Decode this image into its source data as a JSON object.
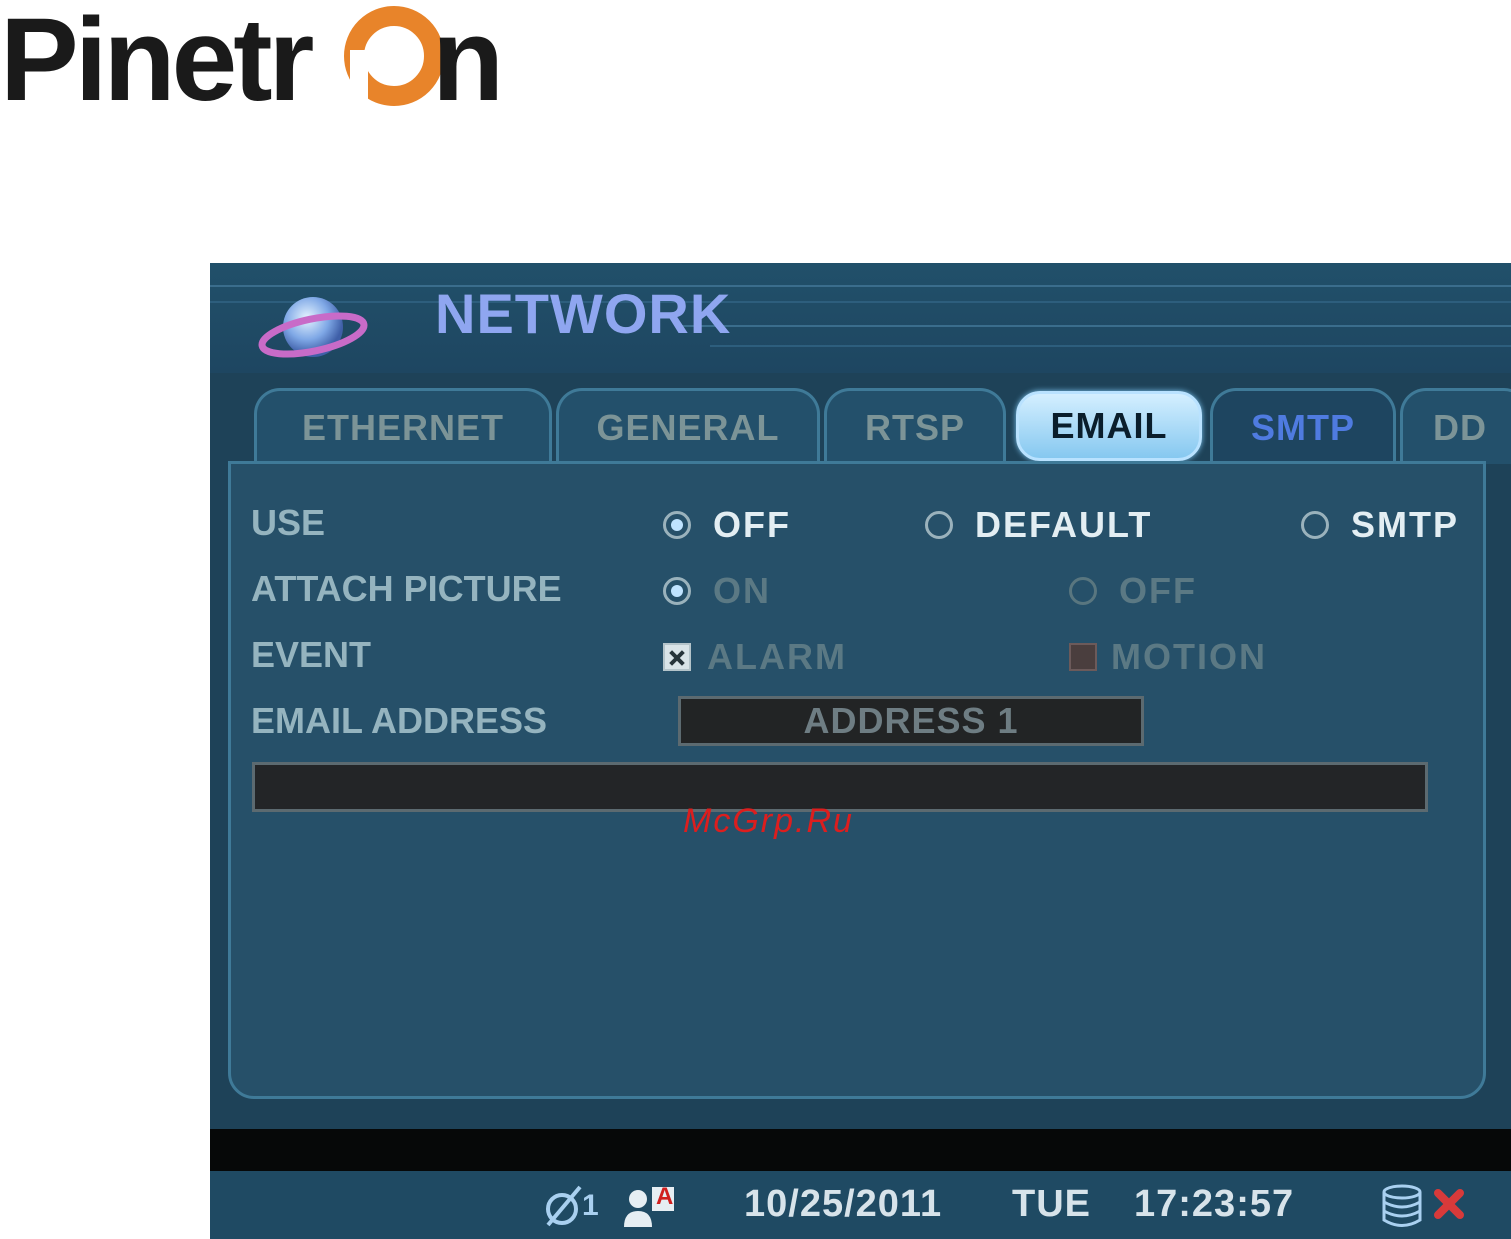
{
  "brand": {
    "logo_text": "Pinetron",
    "orange": "#e8842a",
    "dark": "#1a1a1a"
  },
  "screen": {
    "title": "NETWORK",
    "tabs": [
      {
        "label": "ETHERNET",
        "active": false
      },
      {
        "label": "GENERAL",
        "active": false
      },
      {
        "label": "RTSP",
        "active": false
      },
      {
        "label": "EMAIL",
        "active": true
      },
      {
        "label": "SMTP",
        "active": false
      },
      {
        "label": "DD",
        "active": false
      }
    ],
    "form": {
      "use": {
        "label": "USE",
        "options": [
          "OFF",
          "DEFAULT",
          "SMTP"
        ],
        "selected": "OFF"
      },
      "attach_picture": {
        "label": "ATTACH PICTURE",
        "options": [
          "ON",
          "OFF"
        ],
        "selected": "ON"
      },
      "event": {
        "label": "EVENT",
        "alarm": "ALARM",
        "alarm_checked": true,
        "motion": "MOTION",
        "motion_checked": false
      },
      "email_address": {
        "label": "EMAIL ADDRESS",
        "selected": "ADDRESS 1",
        "value": ""
      }
    },
    "watermark": "McGrp.Ru",
    "status_bar": {
      "channel": "1",
      "date": "10/25/2011",
      "day": "TUE",
      "time": "17:23:57",
      "user_badge": "A"
    }
  }
}
